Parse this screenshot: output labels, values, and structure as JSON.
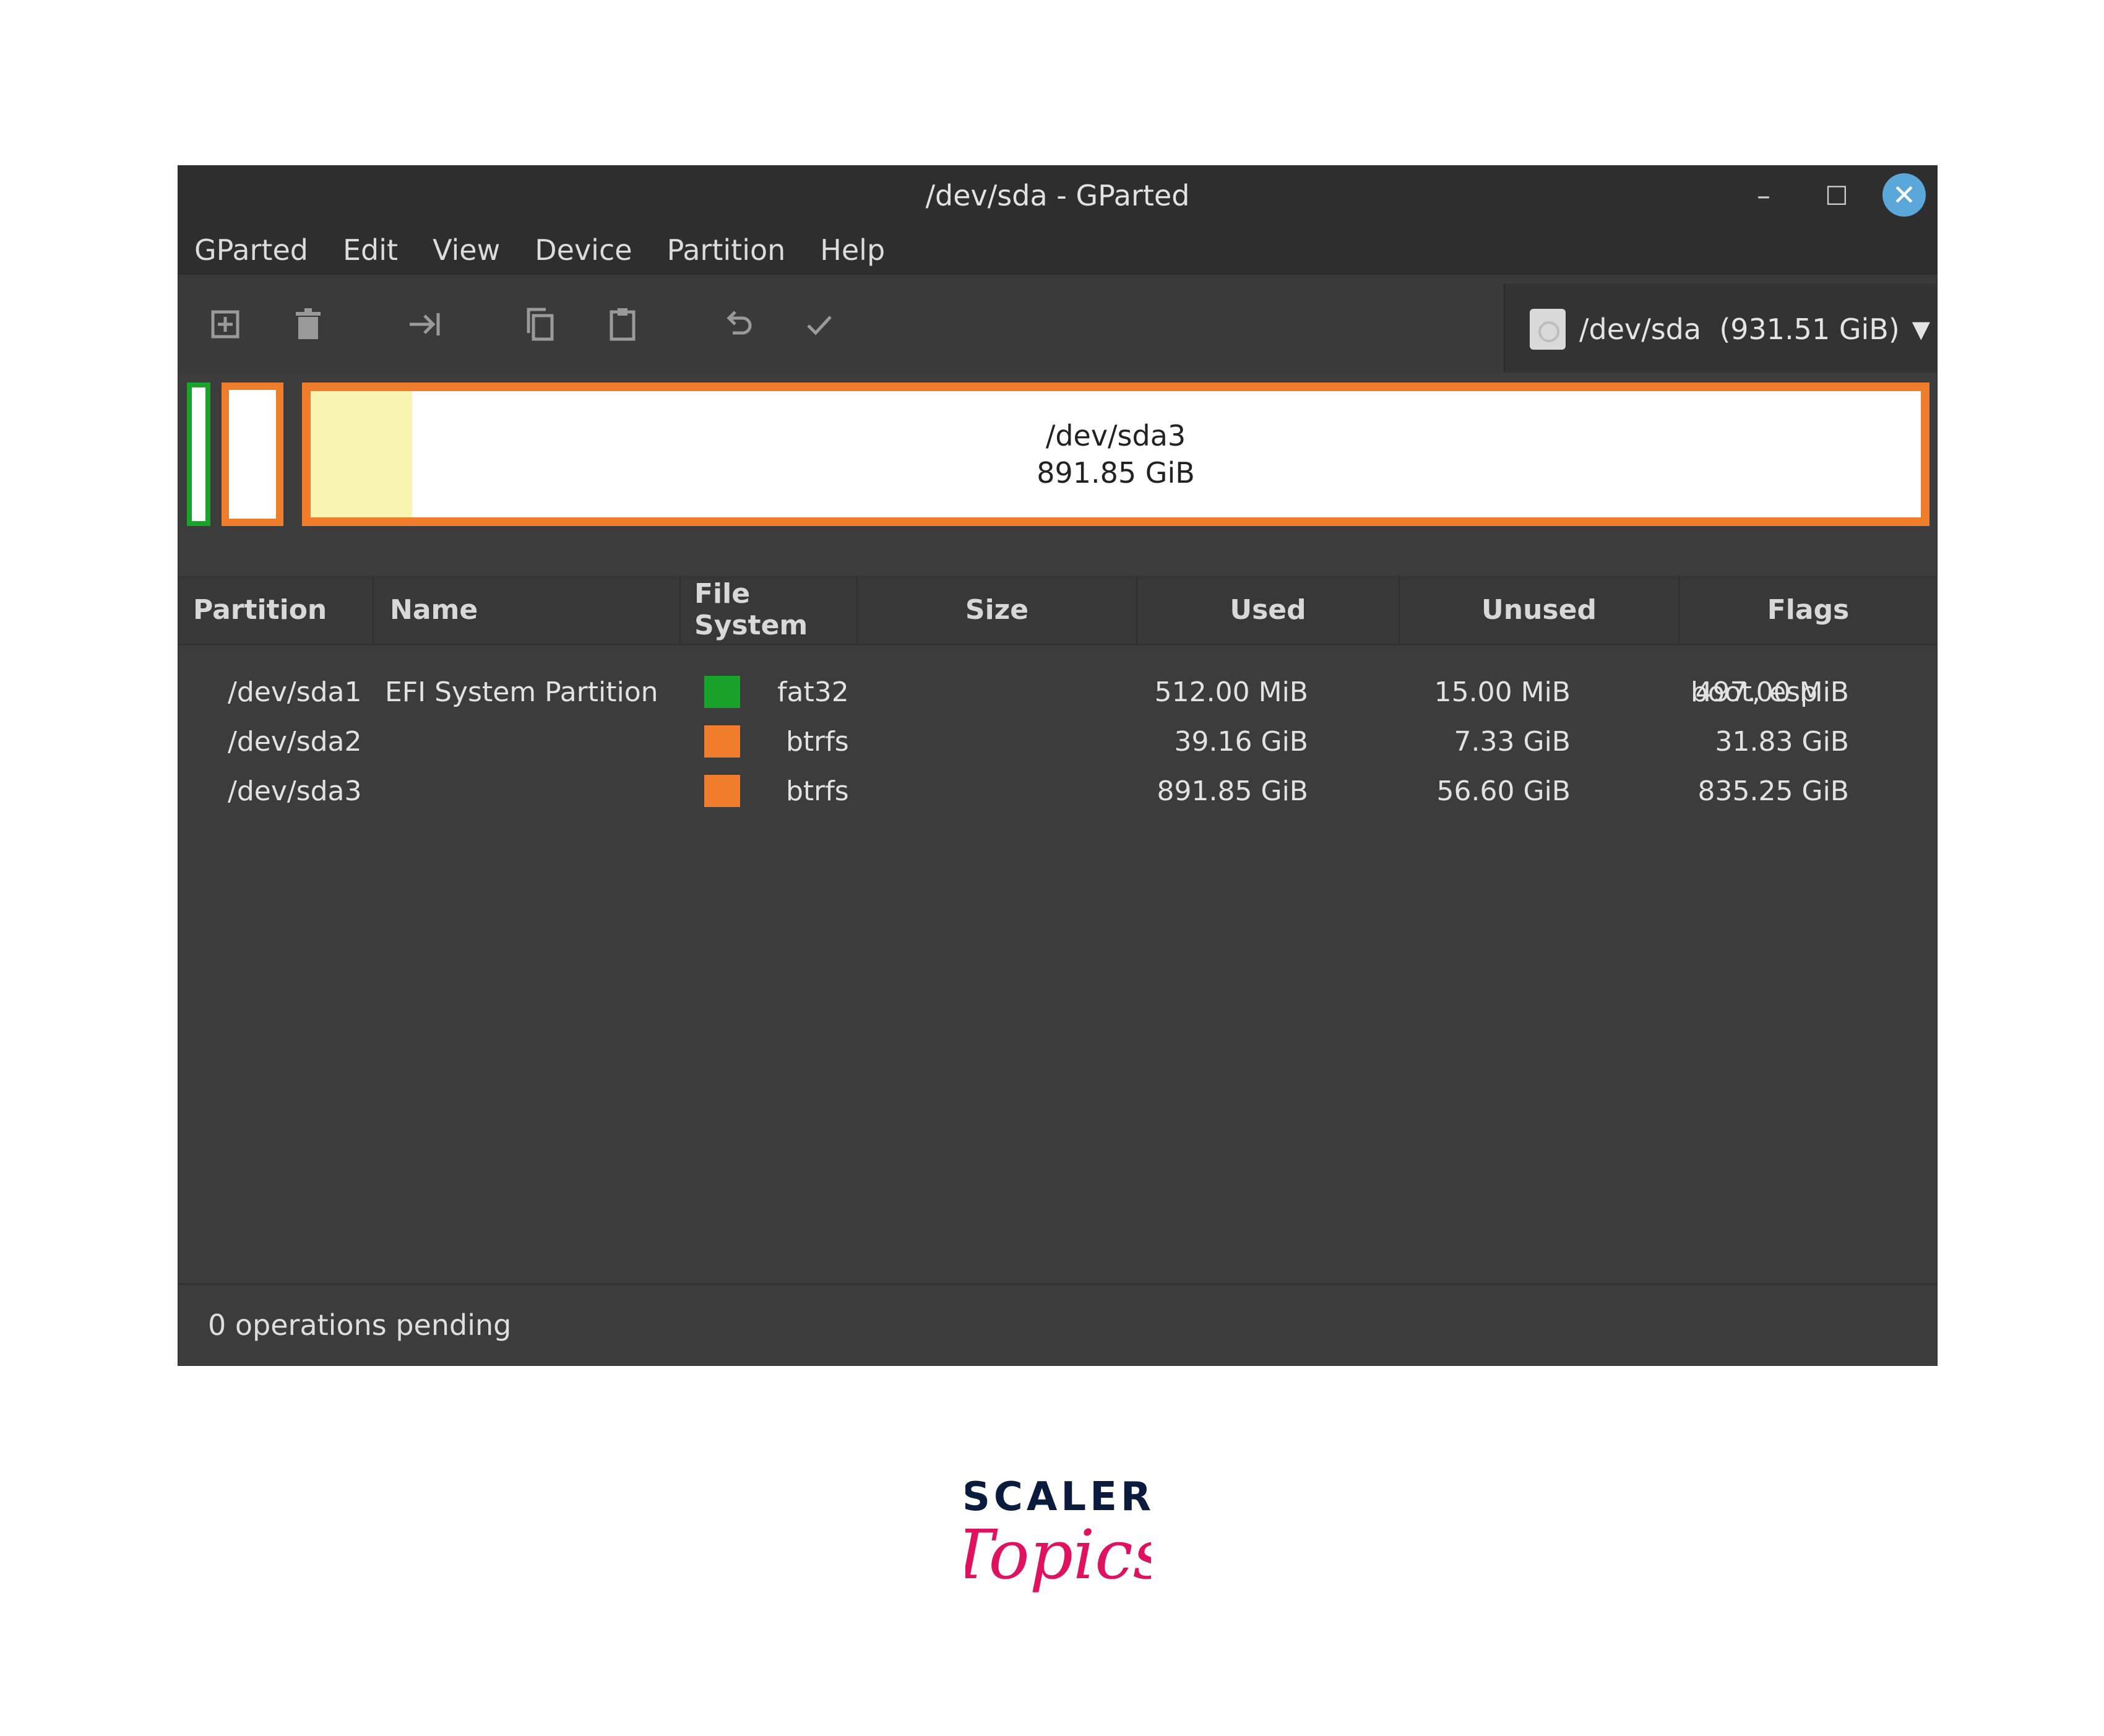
{
  "window": {
    "title": "/dev/sda - GParted",
    "min_glyph": "–",
    "max_glyph": "☐",
    "close_glyph": "✕"
  },
  "menu": [
    "GParted",
    "Edit",
    "View",
    "Device",
    "Partition",
    "Help"
  ],
  "toolbar": {
    "icons": [
      "new-partition-icon",
      "delete-icon",
      "resize-move-icon",
      "copy-icon",
      "paste-icon",
      "undo-icon",
      "apply-icon"
    ],
    "device_selector": "/dev/sda  (931.51 GiB)"
  },
  "disk_map": {
    "sda3_label": "/dev/sda3",
    "sda3_size": "891.85 GiB",
    "sda3_used_fraction": 0.063
  },
  "table": {
    "headers": [
      "Partition",
      "Name",
      "File System",
      "Size",
      "Used",
      "Unused",
      "Flags"
    ],
    "rows": [
      {
        "partition": "/dev/sda1",
        "name": "EFI System Partition",
        "fs": "fat32",
        "fs_color": "#1aa32b",
        "size": "512.00 MiB",
        "used": "15.00 MiB",
        "unused": "497.00 MiB",
        "flags": "boot, esp"
      },
      {
        "partition": "/dev/sda2",
        "name": "",
        "fs": "btrfs",
        "fs_color": "#f07d2c",
        "size": "39.16 GiB",
        "used": "7.33 GiB",
        "unused": "31.83 GiB",
        "flags": ""
      },
      {
        "partition": "/dev/sda3",
        "name": "",
        "fs": "btrfs",
        "fs_color": "#f07d2c",
        "size": "891.85 GiB",
        "used": "56.60 GiB",
        "unused": "835.25 GiB",
        "flags": ""
      }
    ]
  },
  "status": "0 operations pending",
  "brand": {
    "line1": "SCALER",
    "line2": "Topics"
  },
  "colors": {
    "fat32": "#1aa32b",
    "btrfs": "#f07d2c",
    "used": "#f7f5b0",
    "accent": "#5aa7d9"
  }
}
